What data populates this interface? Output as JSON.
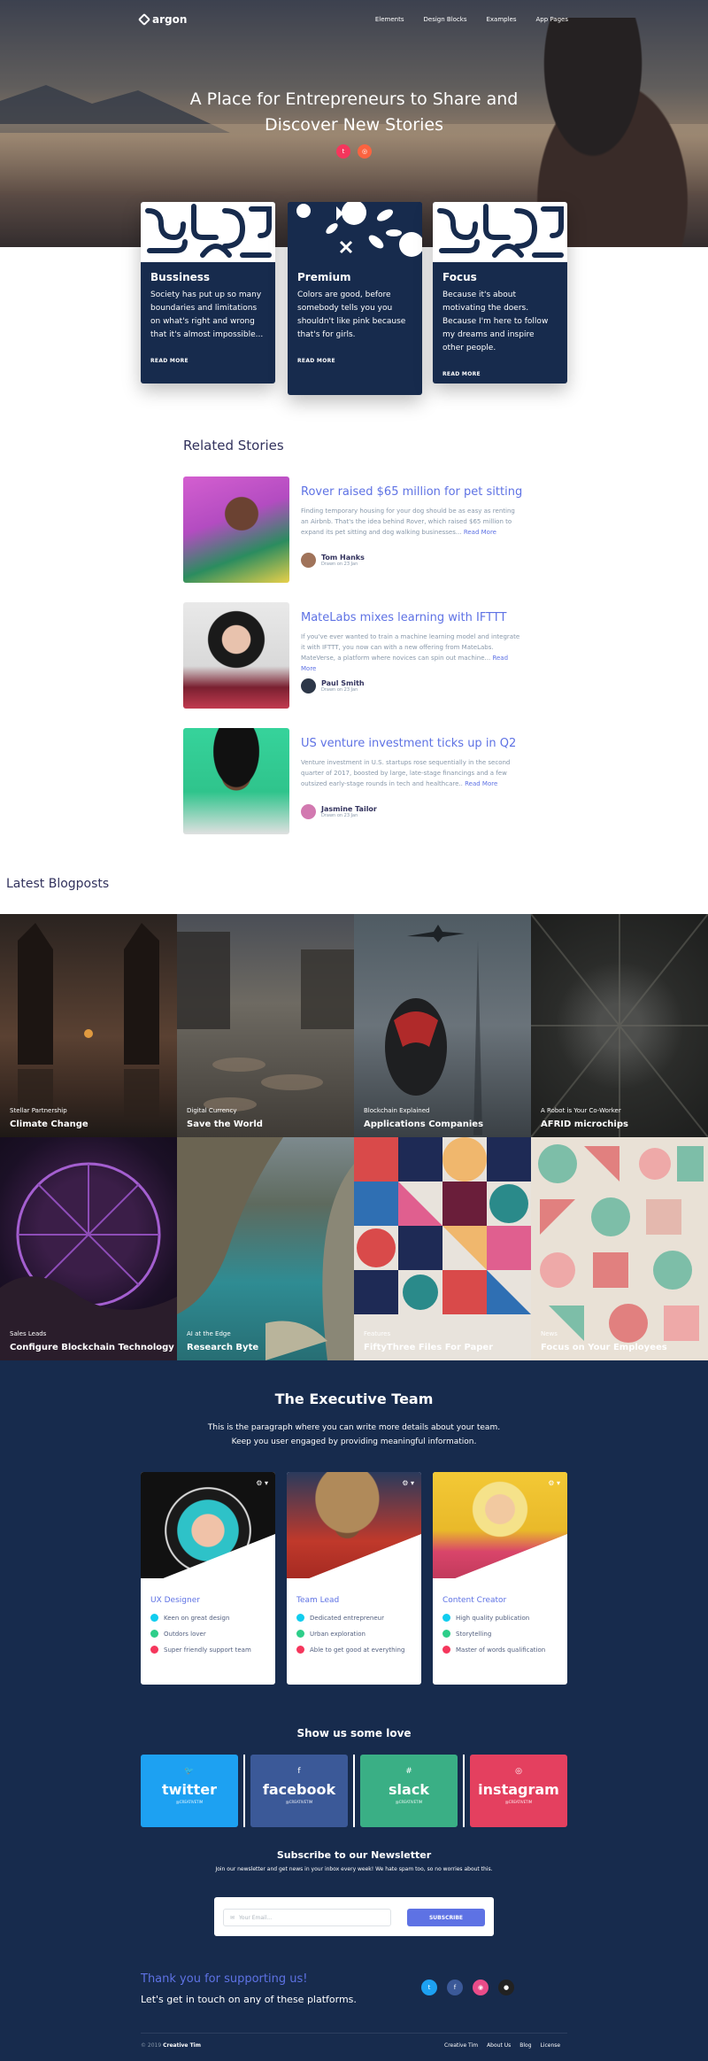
{
  "nav": {
    "brand": "argon",
    "links": [
      "Elements",
      "Design Blocks",
      "Examples",
      "App Pages"
    ]
  },
  "hero": {
    "title_line1": "A Place for Entrepreneurs to Share and",
    "title_line2": "Discover New Stories",
    "social": [
      "twitter-icon",
      "instagram-icon"
    ]
  },
  "cards": [
    {
      "title": "Bussiness",
      "text": "Society has put up so many boundaries and limitations on what's right and wrong that it's almost impossible...",
      "link": "READ MORE"
    },
    {
      "title": "Premium",
      "text": "Colors are good, before somebody tells you you shouldn't like pink because that's for girls.",
      "link": "READ MORE"
    },
    {
      "title": "Focus",
      "text": "Because it's about motivating the doers. Because I'm here to follow my dreams and inspire other people.",
      "link": "READ MORE"
    }
  ],
  "related": {
    "title": "Related Stories",
    "more": "Read More",
    "stories": [
      {
        "title": "Rover raised $65 million for pet sitting",
        "text": "Finding temporary housing for your dog should be as easy as renting an Airbnb. That's the idea behind Rover, which raised $65 million to expand its pet sitting and dog walking businesses...",
        "author": "Tom Hanks",
        "time": "Drawn on 23 Jan"
      },
      {
        "title": "MateLabs mixes learning with IFTTT",
        "text": "If you've ever wanted to train a machine learning model and integrate it with IFTTT, you now can with a new offering from MateLabs. MateVerse, a platform where novices can spin out machine...",
        "author": "Paul Smith",
        "time": "Drawn on 23 Jan"
      },
      {
        "title": "US venture investment ticks up in Q2",
        "text": "Venture investment in U.S. startups rose sequentially in the second quarter of 2017, boosted by large, late-stage financings and a few outsized early-stage rounds in tech and healthcare..",
        "author": "Jasmine Tailor",
        "time": "Drawn on 23 Jan"
      }
    ]
  },
  "blog": {
    "title": "Latest Blogposts",
    "posts": [
      {
        "category": "Stellar Partnership",
        "title": "Climate Change"
      },
      {
        "category": "Digital Currency",
        "title": "Save the World"
      },
      {
        "category": "Blockchain Explained",
        "title": "Applications Companies"
      },
      {
        "category": "A Robot is Your Co-Worker",
        "title": "AFRID microchips"
      },
      {
        "category": "Sales Leads",
        "title": "Configure Blockchain Technology"
      },
      {
        "category": "AI at the Edge",
        "title": "Research Byte"
      },
      {
        "category": "Features",
        "title": "FiftyThree Files For Paper"
      },
      {
        "category": "News",
        "title": "Focus on Your Employees"
      }
    ]
  },
  "team": {
    "title": "The Executive Team",
    "intro1": "This is the paragraph where you can write more details about your team.",
    "intro2": "Keep you user engaged by providing meaningful information.",
    "members": [
      {
        "role": "UX Designer",
        "items": [
          "Keen on great design",
          "Outdors lover",
          "Super friendly support team"
        ]
      },
      {
        "role": "Team Lead",
        "items": [
          "Dedicated entrepreneur",
          "Urban exploration",
          "Able to get good at everything"
        ]
      },
      {
        "role": "Content Creator",
        "items": [
          "High quality publication",
          "Storytelling",
          "Master of words qualification"
        ]
      }
    ]
  },
  "love": {
    "title": "Show us some love",
    "buttons": [
      {
        "name": "twitter",
        "handle": "@CREATIVETIM",
        "color": "#1da1f2"
      },
      {
        "name": "facebook",
        "handle": "@CREATIVETIM",
        "color": "#3b5998"
      },
      {
        "name": "slack",
        "handle": "@CREATIVETIM",
        "color": "#3aaf85"
      },
      {
        "name": "instagram",
        "handle": "@CREATIVETIM",
        "color": "#e4405f"
      }
    ]
  },
  "newsletter": {
    "title": "Subscribe to our Newsletter",
    "subtitle": "Join our newsletter and get news in your inbox every week! We hate spam too, so no worries about this.",
    "placeholder": "Your Email...",
    "button": "SUBSCRIBE"
  },
  "footer": {
    "thanks": "Thank you for supporting us!",
    "touch": "Let's get in touch on any of these platforms.",
    "copy_prefix": "© 2019",
    "copy_brand": "Creative Tim",
    "links": [
      "Creative Tim",
      "About Us",
      "Blog",
      "License"
    ]
  }
}
